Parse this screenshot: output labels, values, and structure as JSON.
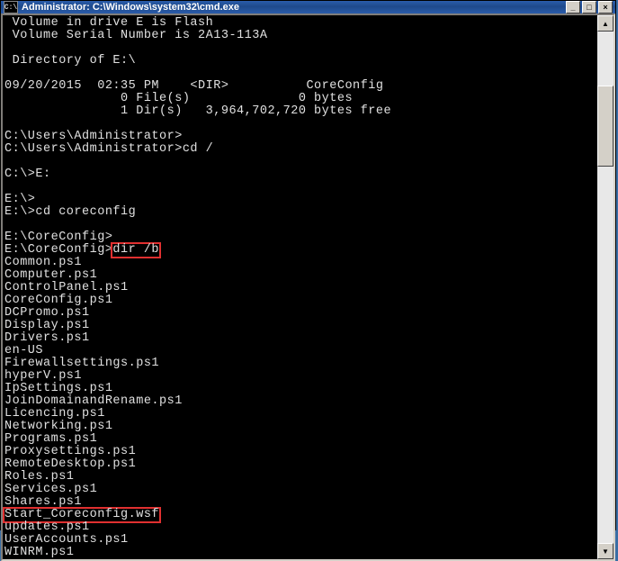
{
  "titlebar": {
    "icon_glyph": "C:\\",
    "title": "Administrator: C:\\Windows\\system32\\cmd.exe",
    "min": "_",
    "max": "□",
    "close": "×"
  },
  "terminal": {
    "lines": [
      " Volume in drive E is Flash",
      " Volume Serial Number is 2A13-113A",
      "",
      " Directory of E:\\",
      "",
      "09/20/2015  02:35 PM    <DIR>          CoreConfig",
      "               0 File(s)              0 bytes",
      "               1 Dir(s)   3,964,702,720 bytes free",
      "",
      "C:\\Users\\Administrator>",
      "C:\\Users\\Administrator>cd /",
      "",
      "C:\\>E:",
      "",
      "E:\\>",
      "E:\\>cd coreconfig",
      "",
      "E:\\CoreConfig>"
    ],
    "prompt_dirline": "E:\\CoreConfig>",
    "cmd_highlight": "dir /b",
    "files": [
      "Common.ps1",
      "Computer.ps1",
      "ControlPanel.ps1",
      "CoreConfig.ps1",
      "DCPromo.ps1",
      "Display.ps1",
      "Drivers.ps1",
      "en-US",
      "Firewallsettings.ps1",
      "hyperV.ps1",
      "IpSettings.ps1",
      "JoinDomainandRename.ps1",
      "Licencing.ps1",
      "Networking.ps1",
      "Programs.ps1",
      "Proxysettings.ps1",
      "RemoteDesktop.ps1",
      "Roles.ps1",
      "Services.ps1",
      "Shares.ps1"
    ],
    "file_highlight": "Start_Coreconfig.wsf",
    "files_after": [
      "updates.ps1",
      "UserAccounts.ps1",
      "WINRM.ps1"
    ]
  },
  "scroll": {
    "up": "▲",
    "down": "▼"
  }
}
